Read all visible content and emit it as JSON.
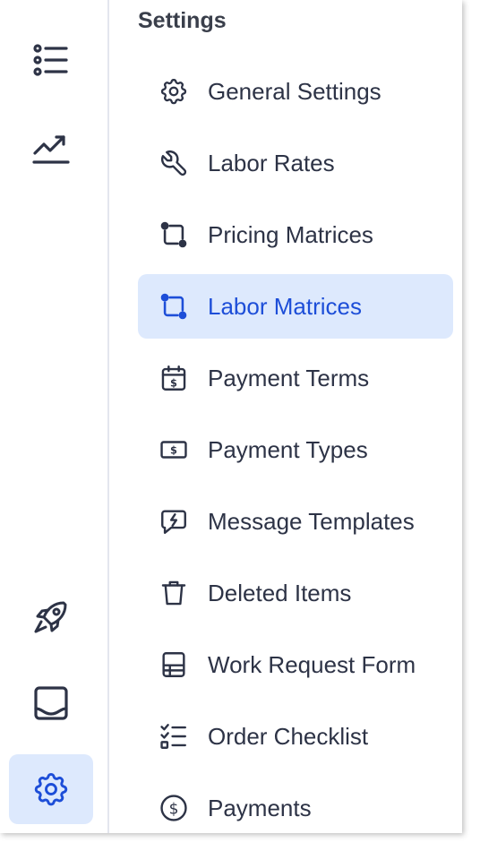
{
  "colors": {
    "active_bg": "#dde9fd",
    "active_fg": "#1d4ed8",
    "text": "#2d3346",
    "title": "#3a3f4b"
  },
  "rail": {
    "items": [
      {
        "icon": "list-icon",
        "active": false
      },
      {
        "icon": "trending-up-icon",
        "active": false
      },
      {
        "icon": "rocket-icon",
        "active": false
      },
      {
        "icon": "inbox-icon",
        "active": false
      },
      {
        "icon": "gear-icon",
        "active": true
      }
    ]
  },
  "settings": {
    "title": "Settings",
    "items": [
      {
        "label": "General Settings",
        "icon": "gear-icon",
        "active": false
      },
      {
        "label": "Labor Rates",
        "icon": "wrench-icon",
        "active": false
      },
      {
        "label": "Pricing Matrices",
        "icon": "matrix-icon",
        "active": false
      },
      {
        "label": "Labor Matrices",
        "icon": "matrix-icon",
        "active": true
      },
      {
        "label": "Payment Terms",
        "icon": "calendar-dollar-icon",
        "active": false
      },
      {
        "label": "Payment Types",
        "icon": "cash-icon",
        "active": false
      },
      {
        "label": "Message Templates",
        "icon": "message-bolt-icon",
        "active": false
      },
      {
        "label": "Deleted Items",
        "icon": "trash-icon",
        "active": false
      },
      {
        "label": "Work Request Form",
        "icon": "form-icon",
        "active": false
      },
      {
        "label": "Order Checklist",
        "icon": "checklist-icon",
        "active": false
      },
      {
        "label": "Payments",
        "icon": "dollar-circle-icon",
        "active": false
      }
    ]
  }
}
